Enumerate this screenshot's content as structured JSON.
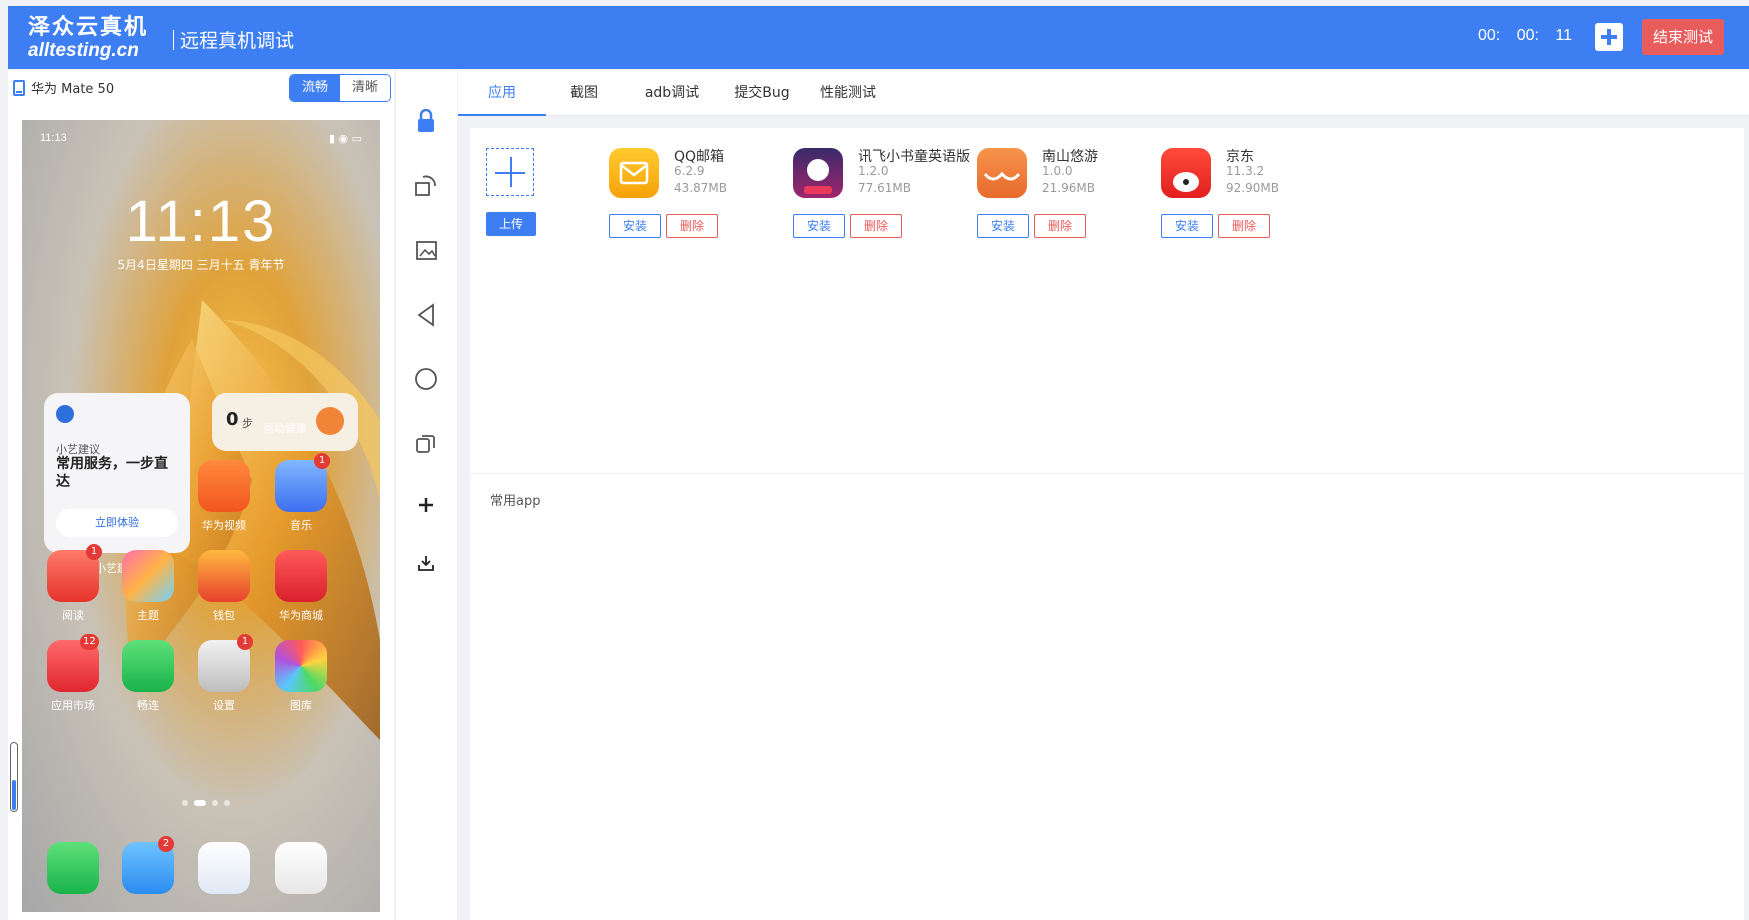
{
  "header": {
    "brand_cn": "泽众云真机",
    "brand_en": "alltesting.cn",
    "title": "远程真机调试",
    "timer": "00: 00: 11",
    "end_label": "结束测试",
    "accent": "#3d7ff3",
    "danger": "#e95c5c"
  },
  "device": {
    "name": "华为 Mate 50",
    "quality_options": [
      "流畅",
      "清晰"
    ],
    "quality_selected": "流畅"
  },
  "phone": {
    "status_time": "11:13",
    "clock": "11:13",
    "date": "5月4日星期四 三月十五 青年节",
    "widget": {
      "sub": "小艺建议",
      "headline": "常用服务，一步直达",
      "button": "立即体验",
      "label": "小艺建议"
    },
    "steps": {
      "count": "0",
      "unit": "步",
      "label": "运动健康"
    },
    "apps": [
      {
        "label": "华为视频",
        "badge": ""
      },
      {
        "label": "音乐",
        "badge": "1"
      },
      {
        "label": "阅读",
        "badge": "1"
      },
      {
        "label": "主题",
        "badge": ""
      },
      {
        "label": "钱包",
        "badge": ""
      },
      {
        "label": "华为商城",
        "badge": ""
      },
      {
        "label": "应用市场",
        "badge": "12"
      },
      {
        "label": "畅连",
        "badge": ""
      },
      {
        "label": "设置",
        "badge": "1"
      },
      {
        "label": "图库",
        "badge": ""
      }
    ],
    "dock_badge": "2"
  },
  "tabs": [
    {
      "label": "应用",
      "active": true
    },
    {
      "label": "截图",
      "active": false
    },
    {
      "label": "adb调试",
      "active": false
    },
    {
      "label": "提交Bug",
      "active": false
    },
    {
      "label": "性能测试",
      "active": false
    }
  ],
  "upload_label": "上传",
  "installed_apps": [
    {
      "name": "QQ邮箱",
      "version": "6.2.9",
      "size": "43.87MB"
    },
    {
      "name": "讯飞小书童英语版",
      "version": "1.2.0",
      "size": "77.61MB"
    },
    {
      "name": "南山悠游",
      "version": "1.0.0",
      "size": "21.96MB"
    },
    {
      "name": "京东",
      "version": "11.3.2",
      "size": "92.90MB"
    }
  ],
  "install_label": "安装",
  "delete_label": "删除",
  "common_apps_label": "常用app",
  "toolbar_icons": [
    "lock-icon",
    "rotate-icon",
    "screenshot-icon",
    "back-icon",
    "home-icon",
    "recent-apps-icon",
    "add-icon",
    "download-icon"
  ]
}
